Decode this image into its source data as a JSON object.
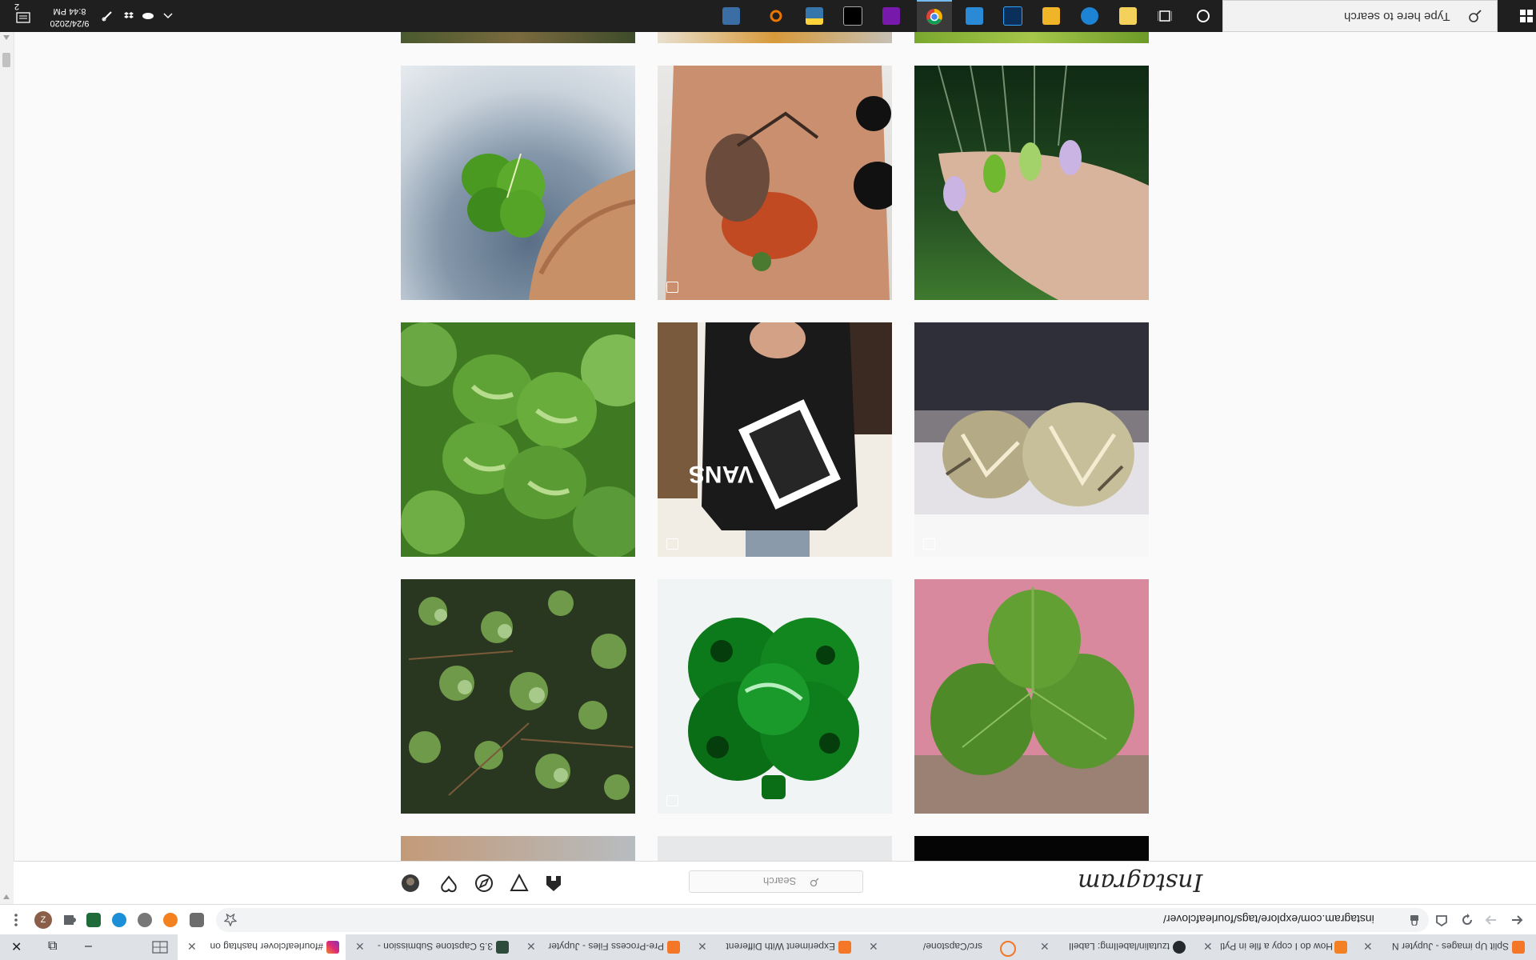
{
  "taskbar": {
    "search_placeholder": "Type here to search",
    "clock_time": "8:44 PM",
    "clock_date": "9/24/2020",
    "notification_count": "2",
    "pinned_apps": [
      "start-icon",
      "cortana-icon",
      "task-view-icon",
      "store-icon",
      "edge-icon",
      "file-explorer-icon",
      "photoshop-icon",
      "mail-icon",
      "chrome-icon",
      "onenote-icon",
      "terminal-icon",
      "python-icon",
      "blender-icon",
      "calculator-icon"
    ]
  },
  "instagram": {
    "logo": "Instagram",
    "search_placeholder": "Search",
    "nav_icons": [
      "home-icon",
      "direct-icon",
      "explore-icon",
      "activity-icon",
      "profile-avatar"
    ]
  },
  "browser": {
    "url": "instagram.com/explore/tags/fourleafclover/",
    "tabs": [
      {
        "label": "Split Up images - Jupyter N",
        "active": false
      },
      {
        "label": "How do I copy a file in Pyth",
        "active": false
      },
      {
        "label": "tzutalin/labelImg: LabelI",
        "active": false
      },
      {
        "label": "src/Capstone/",
        "active": false
      },
      {
        "label": "Experiment With Different",
        "active": false
      },
      {
        "label": "Pre-Process Files - Jupyter",
        "active": false
      },
      {
        "label": "3.5 Capstone Submission -",
        "active": false
      },
      {
        "label": "#fourleafclover hashtag on",
        "active": true
      }
    ]
  },
  "grid": {
    "tiles": [
      {
        "name": "clover-hand-photo",
        "multi": false
      },
      {
        "name": "mushroom-tattoo-photo",
        "multi": true
      },
      {
        "name": "green-nails-photo",
        "multi": false
      },
      {
        "name": "clover-closeup-photo",
        "multi": false
      },
      {
        "name": "vans-shirt-photo",
        "multi": true
      },
      {
        "name": "crystal-rings-photo",
        "multi": true
      },
      {
        "name": "clover-patch-photo",
        "multi": false
      },
      {
        "name": "green-glass-clover-photo",
        "multi": true
      },
      {
        "name": "three-leaf-clover-photo",
        "multi": false
      }
    ]
  }
}
